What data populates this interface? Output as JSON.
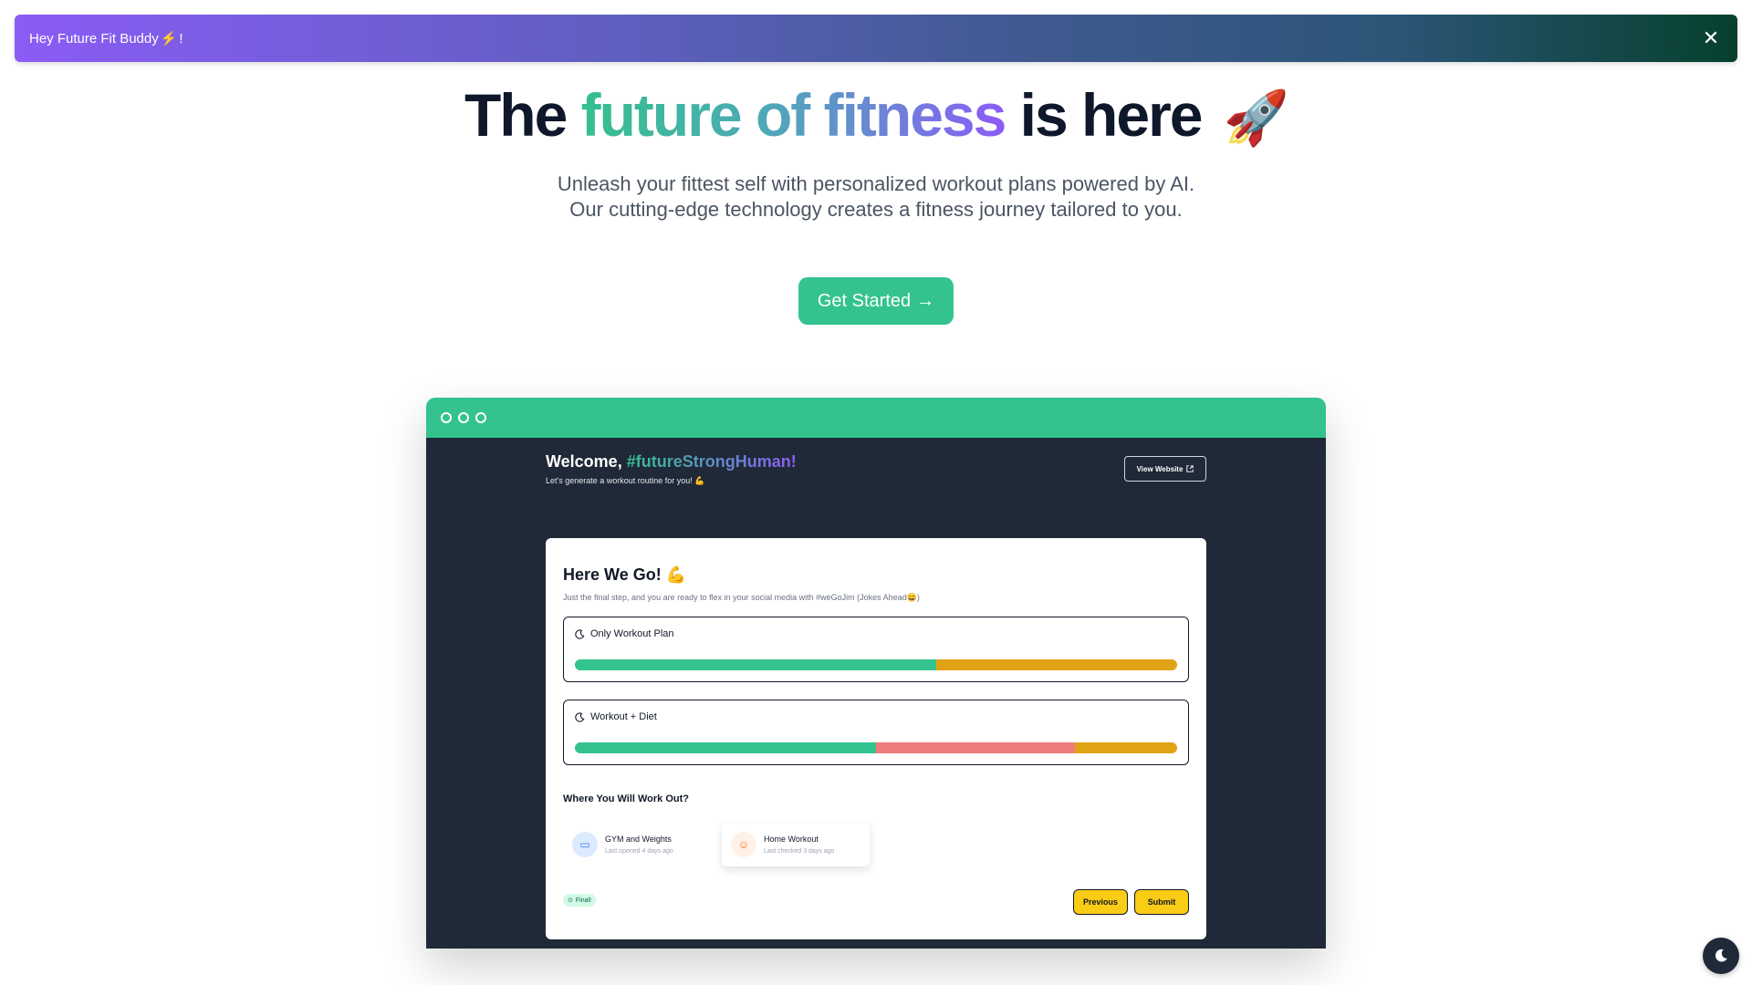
{
  "banner": {
    "text": "Hey Future Fit Buddy",
    "suffix": "!",
    "close_label": "✕"
  },
  "hero": {
    "title_start": "The",
    "title_highlight": "future of fitness",
    "title_end": "is here",
    "title_emoji": "🚀",
    "subtitle": "Unleash your fittest self with personalized workout plans powered by AI. Our cutting-edge technology creates a fitness journey tailored to you.",
    "cta_label": "Get Started",
    "cta_arrow": "→"
  },
  "preview": {
    "welcome_prefix": "Welcome,",
    "welcome_tag": "#futureStrongHuman!",
    "welcome_sub": "Let's generate a workout routine for you! 💪",
    "view_website_label": "View Website",
    "card": {
      "title": "Here We Go!",
      "title_emoji": "💪",
      "subtitle": "Just the final step, and you are ready to flex in your social media with #weGoJim (Jokes Ahead😄)",
      "plans": [
        {
          "label": "Only Workout Plan",
          "segments": [
            {
              "fraction": 0.6,
              "color": "#34c38f"
            },
            {
              "fraction": 0.4,
              "color": "#e0a315"
            }
          ]
        },
        {
          "label": "Workout + Diet",
          "segments": [
            {
              "fraction": 0.5,
              "color": "#34c38f"
            },
            {
              "fraction": 0.33,
              "color": "#f07b7b"
            },
            {
              "fraction": 0.17,
              "color": "#e0a315"
            }
          ]
        }
      ],
      "section_title": "Where You Will Work Out?",
      "options": [
        {
          "title": "GYM and Weights",
          "meta": "Last opened 4 days ago",
          "selected": false
        },
        {
          "title": "Home Workout",
          "meta": "Last checked 3 days ago",
          "selected": true
        }
      ],
      "final_badge": "Final!",
      "previous_label": "Previous",
      "submit_label": "Submit"
    }
  },
  "colors": {
    "accent": "#34c38f",
    "purple": "#8b5cf6",
    "yellow": "#facc15",
    "dark": "#1f2937"
  }
}
